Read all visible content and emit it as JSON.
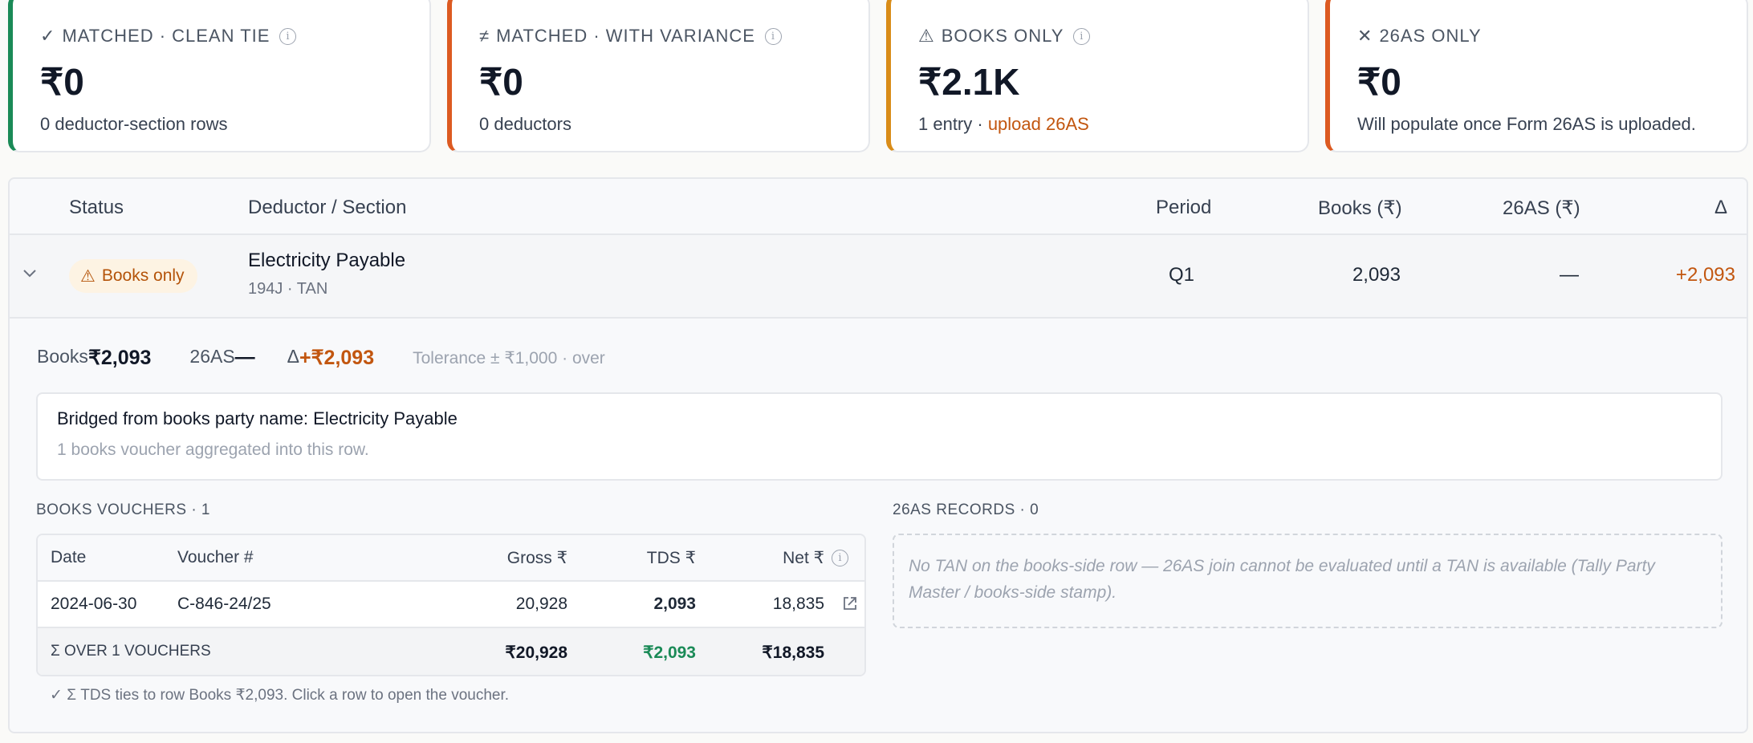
{
  "cards": [
    {
      "glyph": "✓",
      "title": "MATCHED · CLEAN TIE",
      "value": "₹0",
      "sub": "0 deductor-section rows",
      "accent": "#1a8a57"
    },
    {
      "glyph": "≠",
      "title": "MATCHED · WITH VARIANCE",
      "value": "₹0",
      "sub": "0 deductors",
      "accent": "#dc5a21"
    },
    {
      "glyph": "⚠",
      "title": "BOOKS ONLY",
      "value": "₹2.1K",
      "sub": "1 entry · ",
      "sub_link": "upload 26AS",
      "accent": "#d98c18"
    },
    {
      "glyph": "✕",
      "title": "26AS ONLY",
      "value": "₹0",
      "sub": "Will populate once Form 26AS is uploaded.",
      "accent": "#dc5a21"
    }
  ],
  "table": {
    "headers": {
      "status": "Status",
      "deductor": "Deductor / Section",
      "period": "Period",
      "books": "Books (₹)",
      "as26": "26AS (₹)",
      "delta": "Δ"
    },
    "row": {
      "status": "Books only",
      "deductor": "Electricity Payable",
      "section": "194J · TAN",
      "period": "Q1",
      "books": "2,093",
      "as26": "—",
      "delta": "+2,093"
    }
  },
  "detail": {
    "books_label": "Books ",
    "books_value": "₹2,093",
    "as26_label": "26AS ",
    "as26_value": "—",
    "delta_label": "Δ ",
    "delta_value": "+₹2,093",
    "tolerance": "Tolerance ± ₹1,000 · over",
    "bridge_title": "Bridged from books party name: Electricity Payable",
    "bridge_sub": "1 books voucher aggregated into this row.",
    "vouchers_label": "BOOKS VOUCHERS · 1",
    "records_label": "26AS RECORDS · 0",
    "vouchers": {
      "headers": {
        "date": "Date",
        "voucher": "Voucher #",
        "gross": "Gross ₹",
        "tds": "TDS ₹",
        "net": "Net ₹"
      },
      "rows": [
        {
          "date": "2024-06-30",
          "voucher": "C-846-24/25",
          "gross": "20,928",
          "tds": "2,093",
          "net": "18,835"
        }
      ],
      "total": {
        "label": "Σ OVER 1 VOUCHERS",
        "gross": "₹20,928",
        "tds": "₹2,093",
        "net": "₹18,835"
      }
    },
    "records_empty": "No TAN on the books-side row — 26AS join cannot be evaluated until a TAN is available (Tally Party Master / books-side stamp).",
    "footnote": "✓ Σ TDS ties to row Books ₹2,093. Click a row to open the voucher."
  }
}
